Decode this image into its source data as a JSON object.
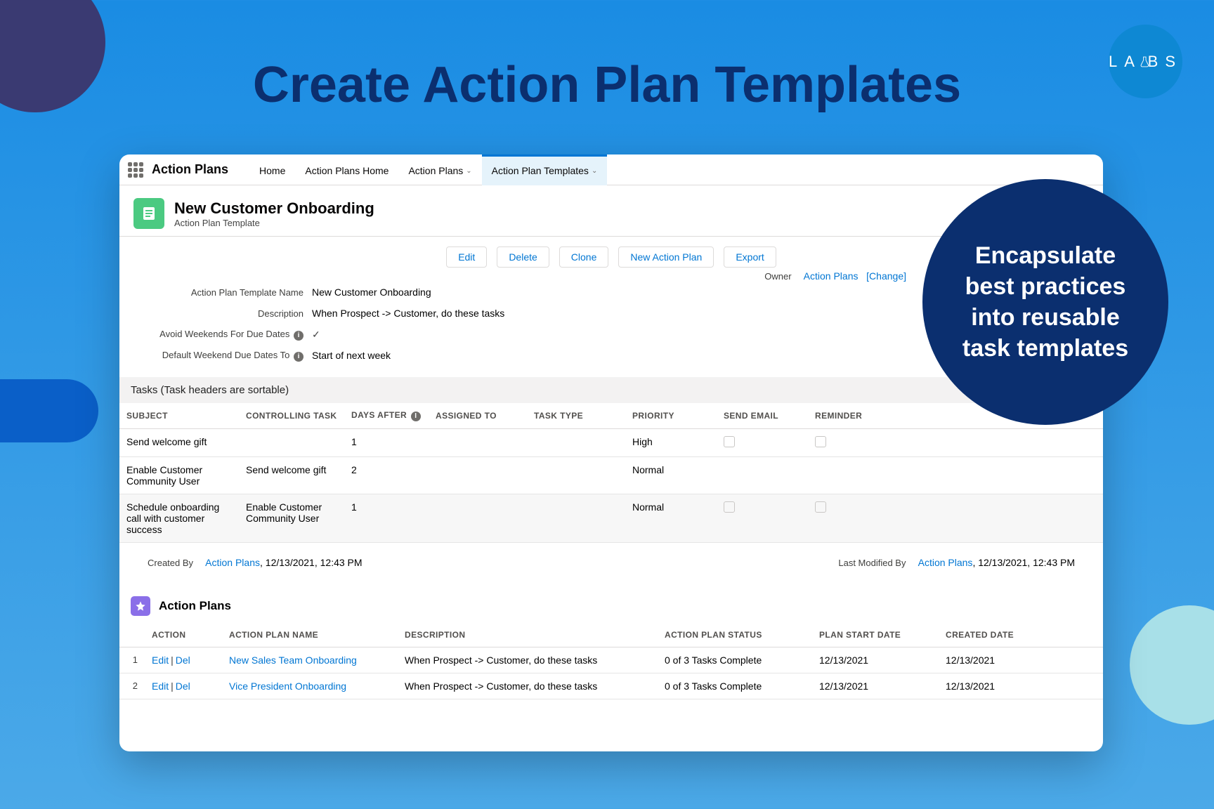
{
  "marketing": {
    "title": "Create Action Plan Templates",
    "callout": "Encapsulate best practices into reusable task templates",
    "labs": {
      "l": "L",
      "a": "A",
      "b": "B",
      "s": "S"
    }
  },
  "nav": {
    "app": "Action Plans",
    "items": [
      "Home",
      "Action Plans Home",
      "Action Plans",
      "Action Plan Templates"
    ]
  },
  "record": {
    "title": "New Customer Onboarding",
    "subtitle": "Action Plan Template"
  },
  "buttons": {
    "edit": "Edit",
    "delete": "Delete",
    "clone": "Clone",
    "newplan": "New Action Plan",
    "export": "Export"
  },
  "fields": {
    "nameLabel": "Action Plan Template Name",
    "nameValue": "New Customer Onboarding",
    "descLabel": "Description",
    "descValue": "When Prospect -> Customer, do these tasks",
    "avoidLabel": "Avoid Weekends For Due Dates",
    "defaultLabel": "Default Weekend Due Dates To",
    "defaultValue": "Start of next week",
    "ownerLabel": "Owner",
    "ownerValue": "Action Plans",
    "ownerChange": "[Change]"
  },
  "tasks": {
    "sectionTitle": "Tasks (Task headers are sortable)",
    "headers": {
      "subject": "Subject",
      "controlling": "Controlling Task",
      "daysAfter": "Days After",
      "assigned": "Assigned To",
      "type": "Task Type",
      "priority": "Priority",
      "email": "Send Email",
      "reminder": "Reminder"
    },
    "rows": [
      {
        "subject": "Send welcome gift",
        "controlling": "",
        "days": "1",
        "assigned": "",
        "type": "",
        "priority": "High"
      },
      {
        "subject": "Enable Customer Community User",
        "controlling": "Send welcome gift",
        "days": "2",
        "assigned": "",
        "type": "",
        "priority": "Normal"
      },
      {
        "subject": "Schedule onboarding call with customer success",
        "controlling": "Enable Customer Community User",
        "days": "1",
        "assigned": "",
        "type": "",
        "priority": "Normal"
      }
    ]
  },
  "meta": {
    "createdByLabel": "Created By",
    "createdByUser": "Action Plans",
    "createdByDate": ", 12/13/2021, 12:43 PM",
    "modifiedByLabel": "Last Modified By",
    "modifiedByUser": "Action Plans",
    "modifiedByDate": ", 12/13/2021, 12:43 PM"
  },
  "related": {
    "title": "Action Plans",
    "headers": {
      "action": "Action",
      "name": "Action Plan Name",
      "desc": "Description",
      "status": "Action Plan Status",
      "start": "Plan Start Date",
      "created": "Created Date"
    },
    "editLabel": "Edit",
    "delLabel": "Del",
    "rows": [
      {
        "num": "1",
        "name": "New Sales Team Onboarding",
        "desc": "When Prospect -> Customer, do these tasks",
        "status": "0 of 3 Tasks Complete",
        "start": "12/13/2021",
        "created": "12/13/2021"
      },
      {
        "num": "2",
        "name": "Vice President Onboarding",
        "desc": "When Prospect -> Customer, do these tasks",
        "status": "0 of 3 Tasks Complete",
        "start": "12/13/2021",
        "created": "12/13/2021"
      }
    ]
  }
}
